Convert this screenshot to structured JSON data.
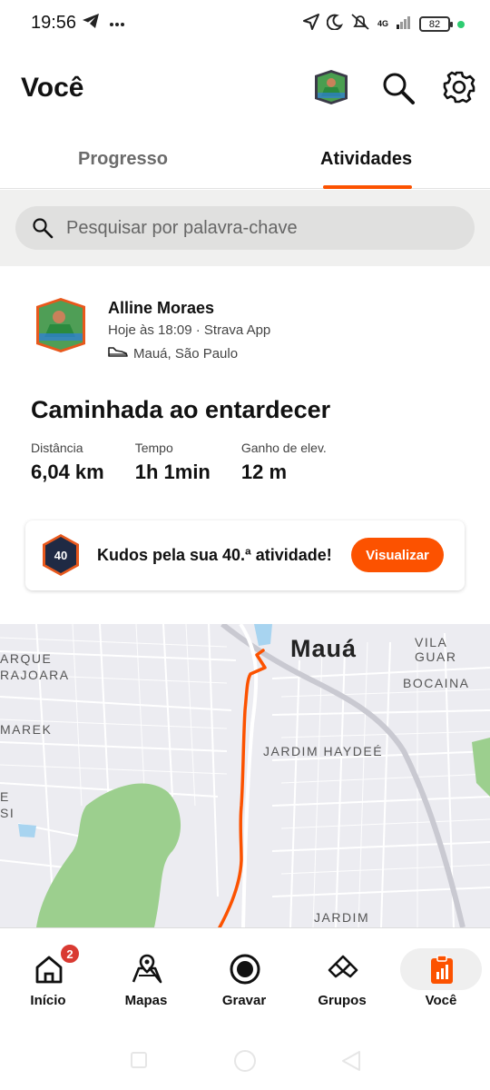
{
  "status_bar": {
    "time": "19:56",
    "network": "4G",
    "battery": "82"
  },
  "header": {
    "title": "Você"
  },
  "tabs": [
    {
      "label": "Progresso"
    },
    {
      "label": "Atividades"
    }
  ],
  "search": {
    "placeholder": "Pesquisar por palavra-chave"
  },
  "activity": {
    "athlete_name": "Alline Moraes",
    "meta": "Hoje às 18:09 · Strava App",
    "location": "Mauá, São Paulo",
    "title": "Caminhada ao entardecer",
    "stats": [
      {
        "label": "Distância",
        "value": "6,04 km"
      },
      {
        "label": "Tempo",
        "value": "1h 1min"
      },
      {
        "label": "Ganho de elev.",
        "value": "12 m"
      }
    ]
  },
  "kudos": {
    "badge_number": "40",
    "text": "Kudos pela sua 40.ª atividade!",
    "button_label": "Visualizar"
  },
  "map": {
    "city": "Mauá",
    "labels": [
      "ARQUE",
      "RAJOARA",
      "MAREK",
      "E",
      "SI",
      "VILA GUAR",
      "BOCAINA",
      "JARDIM HAYDEÉ",
      "JARDIM"
    ],
    "route_color": "#fc5200"
  },
  "bottom_nav": {
    "items": [
      {
        "label": "Início",
        "badge": "2"
      },
      {
        "label": "Mapas"
      },
      {
        "label": "Gravar"
      },
      {
        "label": "Grupos"
      },
      {
        "label": "Você"
      }
    ]
  },
  "colors": {
    "accent": "#fc5200",
    "badge": "#d93a32"
  }
}
